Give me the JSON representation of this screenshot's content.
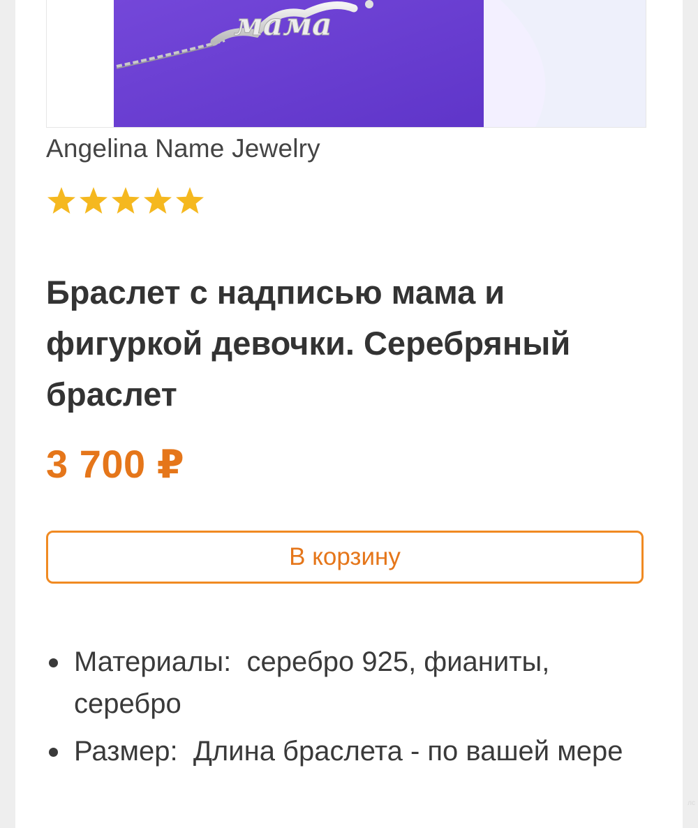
{
  "product_image": {
    "inscription": "мама",
    "background_color": "#6b3fd6"
  },
  "shop": {
    "name": "Angelina Name Jewelry"
  },
  "rating": {
    "stars": 5,
    "max": 5,
    "color": "#f5b81f"
  },
  "product": {
    "title": "Браслет с надписью мама и фигуркой девочки. Серебряный браслет",
    "price": "3 700 ₽"
  },
  "actions": {
    "add_to_cart_label": "В корзину"
  },
  "specs": [
    {
      "label": "Материалы:",
      "value": "серебро 925, фианиты, серебро"
    },
    {
      "label": "Размер:",
      "value": "Длина браслета - по вашей мере"
    }
  ],
  "watermark": "лс",
  "colors": {
    "accent": "#e5761a",
    "button_border": "#f08a22",
    "text": "#333333"
  }
}
